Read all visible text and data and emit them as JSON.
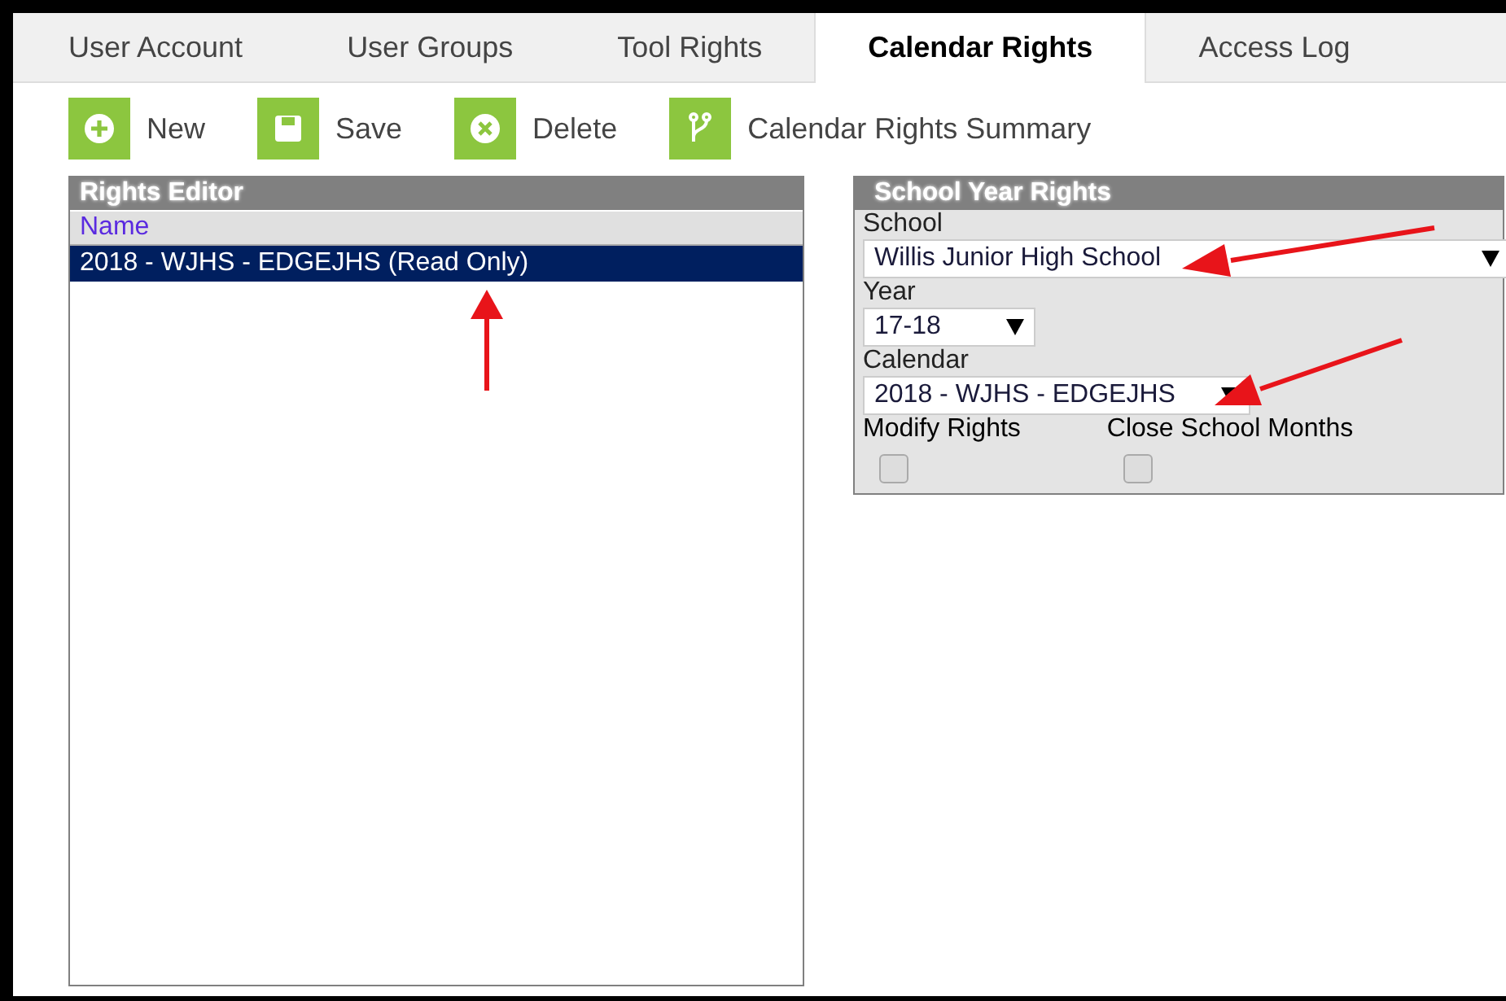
{
  "tabs": [
    {
      "label": "User Account",
      "selected": false
    },
    {
      "label": "User Groups",
      "selected": false
    },
    {
      "label": "Tool Rights",
      "selected": false
    },
    {
      "label": "Calendar Rights",
      "selected": true
    },
    {
      "label": "Access Log",
      "selected": false
    }
  ],
  "toolbar": [
    {
      "kind": "new",
      "label": "New"
    },
    {
      "kind": "save",
      "label": "Save"
    },
    {
      "kind": "delete",
      "label": "Delete"
    },
    {
      "kind": "summary",
      "label": "Calendar Rights Summary"
    }
  ],
  "rights_editor": {
    "title": "Rights Editor",
    "column": "Name",
    "rows": [
      {
        "name": "2018 - WJHS - EDGEJHS (Read Only)",
        "selected": true
      }
    ]
  },
  "school_year_rights": {
    "title": "School Year Rights",
    "school": {
      "label": "School",
      "value": "Willis Junior High School"
    },
    "year": {
      "label": "Year",
      "value": "17-18"
    },
    "calendar": {
      "label": "Calendar",
      "value": "2018 - WJHS - EDGEJHS"
    },
    "options": [
      {
        "label": "Modify Rights",
        "checked": false
      },
      {
        "label": "Close School Months",
        "checked": false
      }
    ]
  }
}
